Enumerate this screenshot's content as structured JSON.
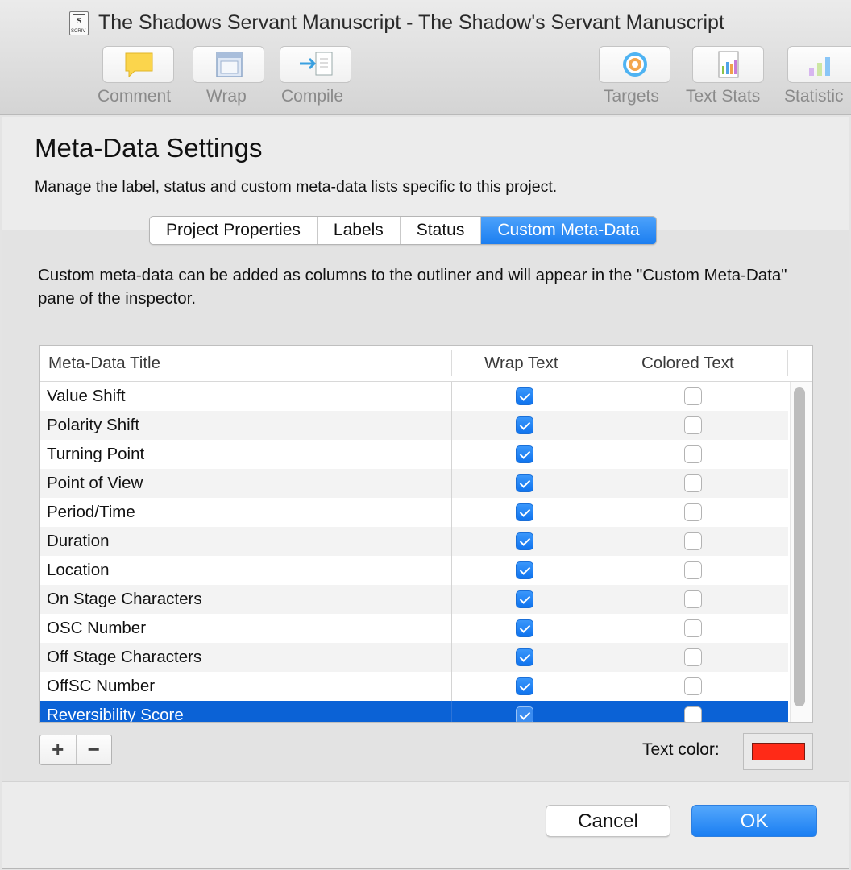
{
  "window": {
    "title": "The Shadows Servant Manuscript - The Shadow's Servant Manuscript",
    "doc_icon_tag": "SCRIV"
  },
  "toolbar": {
    "items": [
      {
        "label": "Comment",
        "icon": "comment-icon"
      },
      {
        "label": "Wrap",
        "icon": "wrap-icon"
      },
      {
        "label": "Compile",
        "icon": "compile-icon"
      },
      {
        "label": "Targets",
        "icon": "targets-icon"
      },
      {
        "label": "Text Stats",
        "icon": "text-stats-icon"
      },
      {
        "label": "Statistic",
        "icon": "statistics-icon"
      }
    ]
  },
  "dialog": {
    "title": "Meta-Data Settings",
    "subtitle": "Manage the label, status and custom meta-data lists specific to this project.",
    "tabs": [
      {
        "label": "Project Properties",
        "active": false
      },
      {
        "label": "Labels",
        "active": false
      },
      {
        "label": "Status",
        "active": false
      },
      {
        "label": "Custom Meta-Data",
        "active": true
      }
    ],
    "description": "Custom meta-data can be added as columns to the outliner and will appear in the \"Custom Meta-Data\" pane of the inspector.",
    "table": {
      "columns": [
        "Meta-Data Title",
        "Wrap Text",
        "Colored Text"
      ],
      "rows": [
        {
          "title": "Value Shift",
          "wrap": true,
          "colored": false
        },
        {
          "title": "Polarity Shift",
          "wrap": true,
          "colored": false
        },
        {
          "title": "Turning Point",
          "wrap": true,
          "colored": false
        },
        {
          "title": "Point of View",
          "wrap": true,
          "colored": false
        },
        {
          "title": "Period/Time",
          "wrap": true,
          "colored": false
        },
        {
          "title": "Duration",
          "wrap": true,
          "colored": false
        },
        {
          "title": "Location",
          "wrap": true,
          "colored": false
        },
        {
          "title": "On Stage Characters",
          "wrap": true,
          "colored": false
        },
        {
          "title": "OSC Number",
          "wrap": true,
          "colored": false
        },
        {
          "title": "Off Stage Characters",
          "wrap": true,
          "colored": false
        },
        {
          "title": "OffSC Number",
          "wrap": true,
          "colored": false
        },
        {
          "title": "Reversibility Score",
          "wrap": true,
          "colored": false,
          "selected": true
        }
      ]
    },
    "add_label": "+",
    "remove_label": "−",
    "text_color_label": "Text color:",
    "text_color_value": "#ff2a17",
    "cancel_label": "Cancel",
    "ok_label": "OK"
  }
}
